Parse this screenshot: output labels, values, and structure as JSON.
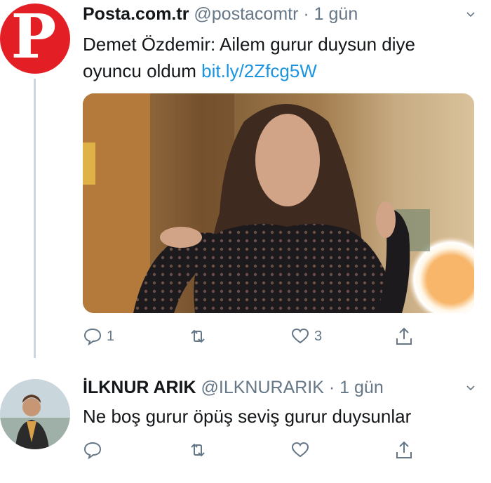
{
  "tweet1": {
    "display_name": "Posta.com.tr",
    "handle": "@postacomtr",
    "separator": "·",
    "time": "1 gün",
    "avatar_letter": "P",
    "text": "Demet Özdemir: Ailem gurur duysun diye oyuncu oldum",
    "link": "bit.ly/2Zfcg5W",
    "reply_count": "1",
    "retweet_count": "",
    "like_count": "3"
  },
  "tweet2": {
    "display_name": "İLKNUR ARIK",
    "handle": "@ILKNURARIK",
    "separator": "·",
    "time": "1 gün",
    "text": "Ne boş gurur öpüş seviş gurur duysunlar",
    "reply_count": "",
    "retweet_count": "",
    "like_count": ""
  },
  "icons": {
    "reply": "reply-icon",
    "retweet": "retweet-icon",
    "like": "heart-icon",
    "share": "share-icon",
    "more": "chevron-down-icon"
  },
  "colors": {
    "link": "#1b95e0",
    "muted": "#657786",
    "brand_red": "#e31e24"
  }
}
